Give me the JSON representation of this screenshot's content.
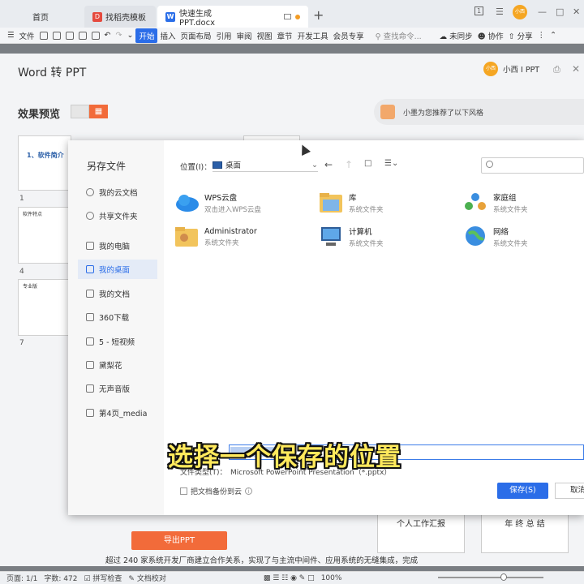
{
  "titlebar": {
    "tabs": [
      {
        "label": "首页"
      },
      {
        "label": "找稻壳模板"
      },
      {
        "label": "快速生成PPT.docx"
      }
    ],
    "badge": "1",
    "user_short": "小西"
  },
  "ribbon": {
    "items": [
      "文件",
      "开始",
      "插入",
      "页面布局",
      "引用",
      "审阅",
      "视图",
      "章节",
      "开发工具",
      "会员专享"
    ],
    "search": "查找命令...",
    "sync": "未同步",
    "collab": "协作",
    "share": "分享"
  },
  "panel": {
    "title": "Word 转 PPT",
    "user": "小西 I PPT",
    "user_short": "小西",
    "preview_label": "效果预览",
    "recommend": "小墨为您推荐了以下风格",
    "thumb_title": "1、软件简介",
    "thumb_labels": [
      "软件特点",
      "专业版"
    ],
    "page_nums": [
      "1",
      "4",
      "7"
    ],
    "export": "导出PPT",
    "templates": [
      "个人工作汇报",
      "年 终 总 结"
    ]
  },
  "dialog": {
    "title": "另存文件",
    "sidebar": [
      "我的云文档",
      "共享文件夹",
      "我的电脑",
      "我的桌面",
      "我的文档",
      "360下载",
      "5 - 短视频",
      "黛梨花",
      "无声音版",
      "第4页_media"
    ],
    "selected": "我的桌面",
    "location_label": "位置(I)：",
    "location_value": "桌面",
    "files": [
      {
        "name": "WPS云盘",
        "sub": "双击进入WPS云盘"
      },
      {
        "name": "库",
        "sub": "系统文件夹"
      },
      {
        "name": "家庭组",
        "sub": "系统文件夹"
      },
      {
        "name": "Administrator",
        "sub": "系统文件夹"
      },
      {
        "name": "计算机",
        "sub": "系统文件夹"
      },
      {
        "name": "网络",
        "sub": "系统文件夹"
      }
    ],
    "filetype_label": "文件类型(T)：",
    "filetype_value": "Microsoft PowerPoint Presentation（*.pptx）",
    "backup": "把文档备份到云",
    "save": "保存(S)",
    "cancel": "取消"
  },
  "caption": "选择一个保存的位置",
  "doc_text": "超过 240 家系统开发厂商建立合作关系，实现了与主流中间件、应用系统的无缝集成，完成",
  "statusbar": {
    "page": "页面: 1/1",
    "words": "字数: 472",
    "spell": "拼写检查",
    "proof": "文档校对",
    "zoom": "100%"
  },
  "colors": {
    "accent": "#2b6de8",
    "orange": "#f26b3a",
    "caption": "#ffe95c"
  }
}
